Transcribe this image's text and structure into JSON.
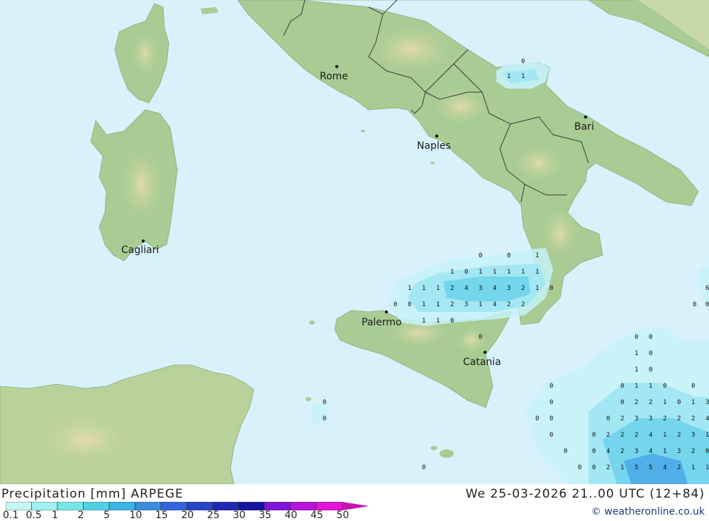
{
  "map": {
    "cities": [
      {
        "name": "Rome"
      },
      {
        "name": "Naples"
      },
      {
        "name": "Bari"
      },
      {
        "name": "Cagliari"
      },
      {
        "name": "Palermo"
      },
      {
        "name": "Catania"
      }
    ]
  },
  "footer": {
    "title": "Precipitation [mm] ARPEGE",
    "datetime": "We 25-03-2026 21..00 UTC (12+84)",
    "credit": "© weatheronline.co.uk"
  },
  "legend": {
    "values": [
      "0.1",
      "0.5",
      "1",
      "2",
      "5",
      "10",
      "15",
      "20",
      "25",
      "30",
      "35",
      "40",
      "45",
      "50"
    ],
    "colors": [
      "#c8f5f5",
      "#a0f0f0",
      "#78e6e6",
      "#50d2e6",
      "#3cb4e6",
      "#3c8cdc",
      "#3264dc",
      "#2846c8",
      "#1e28b4",
      "#1414a0",
      "#8214dc",
      "#b414dc",
      "#e614dc",
      "#c814b4"
    ]
  },
  "colors": {
    "sea": "#d9f1fb",
    "land": "#a9cc94",
    "land_dark": "#8fb87a",
    "mountain": "#d8cda0",
    "border": "#3a3a3a",
    "precip_light": "#c6f2f8",
    "precip_mid": "#9fe6f3",
    "precip_heavy": "#6fd3ec",
    "precip_strong": "#4aa8e6"
  }
}
